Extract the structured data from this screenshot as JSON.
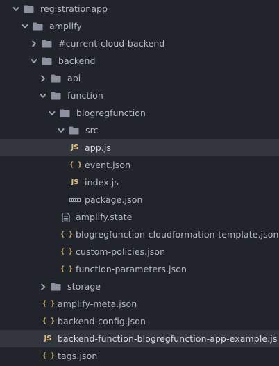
{
  "tree": {
    "items": [
      {
        "label": "registrationapp",
        "kind": "folder",
        "expanded": true,
        "depth": 0
      },
      {
        "label": "amplify",
        "kind": "folder",
        "expanded": true,
        "depth": 1
      },
      {
        "label": "#current-cloud-backend",
        "kind": "folder",
        "expanded": false,
        "depth": 2
      },
      {
        "label": "backend",
        "kind": "folder",
        "expanded": true,
        "depth": 2
      },
      {
        "label": "api",
        "kind": "folder",
        "expanded": false,
        "depth": 3
      },
      {
        "label": "function",
        "kind": "folder",
        "expanded": true,
        "depth": 3
      },
      {
        "label": "blogregfunction",
        "kind": "folder",
        "expanded": true,
        "depth": 4
      },
      {
        "label": "src",
        "kind": "folder",
        "expanded": true,
        "depth": 5
      },
      {
        "label": "app.js",
        "kind": "js",
        "depth": 6,
        "selected": true
      },
      {
        "label": "event.json",
        "kind": "json",
        "depth": 6
      },
      {
        "label": "index.js",
        "kind": "js",
        "depth": 6
      },
      {
        "label": "package.json",
        "kind": "pkg",
        "depth": 6
      },
      {
        "label": "amplify.state",
        "kind": "state",
        "depth": 5
      },
      {
        "label": "blogregfunction-cloudformation-template.json",
        "kind": "json",
        "depth": 5
      },
      {
        "label": "custom-policies.json",
        "kind": "json",
        "depth": 5
      },
      {
        "label": "function-parameters.json",
        "kind": "json",
        "depth": 5
      },
      {
        "label": "storage",
        "kind": "folder",
        "expanded": false,
        "depth": 3
      },
      {
        "label": "amplify-meta.json",
        "kind": "json",
        "depth": 3
      },
      {
        "label": "backend-config.json",
        "kind": "json",
        "depth": 3
      },
      {
        "label": "backend-function-blogregfunction-app-example.js",
        "kind": "js",
        "depth": 3,
        "selected": true
      },
      {
        "label": "tags.json",
        "kind": "json",
        "depth": 3
      }
    ]
  },
  "icons": {
    "js": "JS",
    "json": "{ }"
  },
  "colors": {
    "background": "#21252b",
    "selected_row": "#33363e",
    "text": "#b5bac2",
    "icon_gray": "#9da5b4",
    "js_yellow": "#e5c07b"
  }
}
